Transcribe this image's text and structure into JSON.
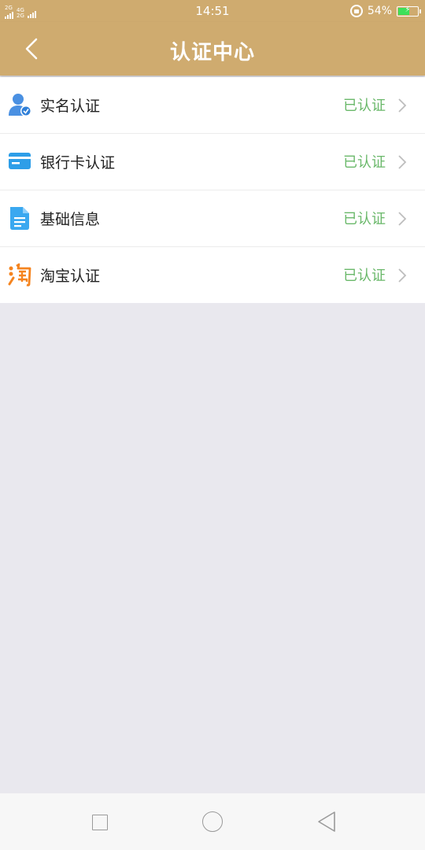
{
  "status_bar": {
    "sim1_label": "2G",
    "sim2_top_label": "4G",
    "sim2_bottom_label": "2G",
    "time": "14:51",
    "battery_text": "54%",
    "battery_level": 0.54,
    "battery_color": "#3de05a"
  },
  "header": {
    "title": "认证中心",
    "back_icon": "chevron-left-icon",
    "background_color": "#cfab6f"
  },
  "items": [
    {
      "label": "实名认证",
      "status": "已认证",
      "icon": "user-verified-icon"
    },
    {
      "label": "银行卡认证",
      "status": "已认证",
      "icon": "bank-card-icon"
    },
    {
      "label": "基础信息",
      "status": "已认证",
      "icon": "document-icon"
    },
    {
      "label": "淘宝认证",
      "status": "已认证",
      "icon": "taobao-icon"
    }
  ],
  "status_color": "#6ab86a",
  "nav_bar": {
    "recent_icon": "square-icon",
    "home_icon": "circle-icon",
    "back_icon": "triangle-back-icon"
  }
}
